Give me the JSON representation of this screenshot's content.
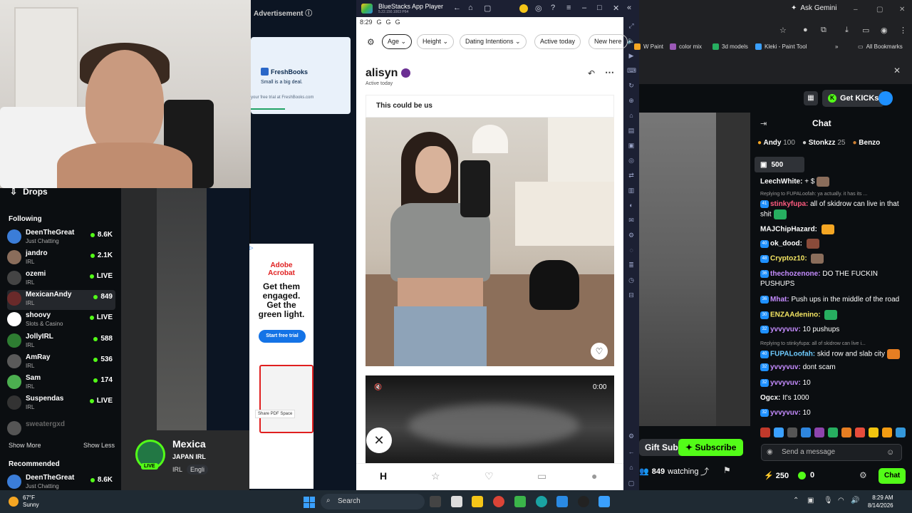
{
  "advertisement": {
    "label": "Advertisement",
    "freshbooks": {
      "brand": "FreshBooks",
      "tagline": "Small is a big deal.",
      "trial": "your free trial at FreshBooks.com"
    },
    "adobe": {
      "brand_line1": "Adobe",
      "brand_line2": "Acrobat",
      "headline_1": "Get them",
      "headline_2": "engaged.",
      "headline_3": "Get the",
      "headline_4": "green light.",
      "cta": "Start free trial",
      "share": "Share PDF Space"
    }
  },
  "sidebar": {
    "drops": "Drops",
    "following_title": "Following",
    "following": [
      {
        "name": "DeenTheGreat",
        "category": "Just Chatting",
        "viewers": "8.6K",
        "color": "#3b7dd8"
      },
      {
        "name": "jandro",
        "category": "IRL",
        "viewers": "2.1K",
        "color": "#8a6d5b"
      },
      {
        "name": "ozemi",
        "category": "IRL",
        "viewers": "LIVE",
        "color": "#444444"
      },
      {
        "name": "MexicanAndy",
        "category": "IRL",
        "viewers": "849",
        "color": "#6a2a2a"
      },
      {
        "name": "shoovy",
        "category": "Slots & Casino",
        "viewers": "LIVE",
        "color": "#ffffff"
      },
      {
        "name": "JollyIRL",
        "category": "IRL",
        "viewers": "588",
        "color": "#2e7d32"
      },
      {
        "name": "AmRay",
        "category": "IRL",
        "viewers": "536",
        "color": "#5a5a5a"
      },
      {
        "name": "Sam",
        "category": "IRL",
        "viewers": "174",
        "color": "#4caf50"
      },
      {
        "name": "Suspendas",
        "category": "IRL",
        "viewers": "LIVE",
        "color": "#333333"
      },
      {
        "name": "sweatergxd",
        "category": "",
        "viewers": "",
        "color": "#555555"
      }
    ],
    "show_more": "Show More",
    "show_less": "Show Less",
    "recommended_title": "Recommended",
    "recommended": [
      {
        "name": "DeenTheGreat",
        "category": "Just Chatting",
        "viewers": "8.6K"
      }
    ]
  },
  "stream": {
    "channel_name": "Mexica",
    "subtitle": "JAPAN IRL",
    "category": "IRL",
    "language": "Engli",
    "live_badge": "LIVE",
    "watching_count": "849",
    "watching_label": "watching",
    "gift_subs": "Gift Subs",
    "subscribe": "Subscribe"
  },
  "bluestacks": {
    "title": "BlueStacks App Player",
    "version": "5.22.150.1003 P64",
    "status_time": "8:29",
    "filters": [
      "Age",
      "Height",
      "Dating Intentions",
      "Active today",
      "New here"
    ],
    "profile_name": "alisyn",
    "profile_status": "Active today",
    "prompt": "This could be us",
    "video_time": "0:00"
  },
  "chrome": {
    "ask_gemini": "Ask Gemini",
    "bookmarks": [
      {
        "label": "W Paint",
        "color": "#f5a623"
      },
      {
        "label": "color mix",
        "color": "#9b59b6"
      },
      {
        "label": "3d models",
        "color": "#27ae60"
      },
      {
        "label": "Kleki - Paint Tool",
        "color": "#3aa0ff"
      }
    ],
    "all_bookmarks": "All Bookmarks"
  },
  "kick_header": {
    "get_kicks": "Get KICKs"
  },
  "chat": {
    "title": "Chat",
    "top_users": [
      {
        "name": "Andy",
        "points": "100"
      },
      {
        "name": "Stonkzz",
        "points": "25"
      },
      {
        "name": "Benzo",
        "points": ""
      }
    ],
    "gift_amount": "500",
    "messages": [
      {
        "user": "LeechWhite:",
        "text": "+ $",
        "color": "#ffffff",
        "reply": "",
        "badge": ""
      },
      {
        "user": "stinkyfupa:",
        "text": "all of skidrow can live in that shit",
        "color": "#ff5b7f",
        "reply": "Replying to FUPALoofah: ya actually. it has its ...",
        "badge": "41"
      },
      {
        "user": "MAJChipHazard:",
        "text": "",
        "color": "#ffffff",
        "reply": "",
        "badge": ""
      },
      {
        "user": "ok_dood:",
        "text": "",
        "color": "#ffffff",
        "reply": "",
        "badge": "40"
      },
      {
        "user": "Cryptoz10:",
        "text": "",
        "color": "#f5e663",
        "reply": "",
        "badge": "48"
      },
      {
        "user": "thechozenone:",
        "text": "DO THE FUCKIN PUSHUPS",
        "color": "#c58cff",
        "reply": "",
        "badge": "36"
      },
      {
        "user": "Mhat:",
        "text": "Push ups in the middle of the road",
        "color": "#c58cff",
        "reply": "",
        "badge": "36"
      },
      {
        "user": "ENZAAdenino:",
        "text": "",
        "color": "#f5e663",
        "reply": "",
        "badge": "30"
      },
      {
        "user": "yvvyvuv:",
        "text": "10 pushups",
        "color": "#c58cff",
        "reply": "",
        "badge": "32"
      },
      {
        "user": "FUPALoofah:",
        "text": "skid row and slab city",
        "color": "#6ecbff",
        "reply": "Replying to stinkyfupa: all of skidrow can live i...",
        "badge": "40"
      },
      {
        "user": "yvvyvuv:",
        "text": "dont scam",
        "color": "#c58cff",
        "reply": "",
        "badge": "32"
      },
      {
        "user": "yvvyvuv:",
        "text": "10",
        "color": "#c58cff",
        "reply": "",
        "badge": "32"
      },
      {
        "user": "Ogcx:",
        "text": "It's 1000",
        "color": "#ffffff",
        "reply": "",
        "badge": ""
      },
      {
        "user": "yvvyvuv:",
        "text": "10",
        "color": "#c58cff",
        "reply": "",
        "badge": "32"
      }
    ],
    "input_placeholder": "Send a message",
    "points_left": "250",
    "points_kick": "0",
    "chat_button": "Chat"
  },
  "taskbar": {
    "temperature": "67°F",
    "weather": "Sunny",
    "search": "Search",
    "time": "8:29 AM",
    "date": "8/14/2026"
  }
}
